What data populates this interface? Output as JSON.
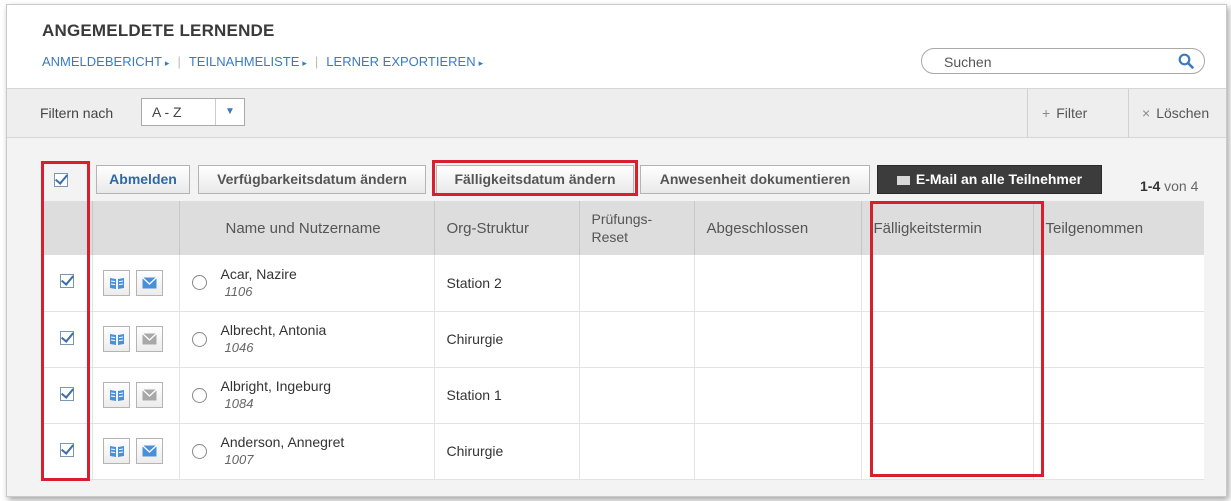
{
  "header": {
    "title": "ANGEMELDETE LERNENDE",
    "links": [
      "ANMELDEBERICHT",
      "TEILNAHMELISTE",
      "LERNER EXPORTIEREN"
    ],
    "search_placeholder": "Suchen"
  },
  "filterbar": {
    "label": "Filtern nach",
    "select_value": "A - Z",
    "filter_label": "Filter",
    "clear_label": "Löschen"
  },
  "toolbar": {
    "unregister": "Abmelden",
    "availability": "Verfügbarkeitsdatum ändern",
    "duedate": "Fälligkeitsdatum ändern",
    "attendance": "Anwesenheit dokumentieren",
    "email_all": "E-Mail an alle Teilnehmer",
    "count_range": "1-4",
    "count_suffix": "von 4"
  },
  "table": {
    "columns": [
      "Name und Nutzername",
      "Org-Struktur",
      "Prüfungs-",
      "Reset",
      "Abgeschlossen",
      "Fälligkeitstermin",
      "Teilgenommen"
    ],
    "rows": [
      {
        "name": "Acar, Nazire",
        "id": "1106",
        "org": "Station 2",
        "mail_active": true
      },
      {
        "name": "Albrecht, Antonia",
        "id": "1046",
        "org": "Chirurgie",
        "mail_active": false
      },
      {
        "name": "Albright, Ingeburg",
        "id": "1084",
        "org": "Station 1",
        "mail_active": false
      },
      {
        "name": "Anderson, Annegret",
        "id": "1007",
        "org": "Chirurgie",
        "mail_active": true
      }
    ]
  },
  "colors": {
    "accent": "#3a7bbf",
    "highlight": "#d71f2e",
    "dark_button": "#3c3c3c"
  },
  "icons": [
    "search-icon",
    "caret-right-icon",
    "chevron-down-icon",
    "plus-icon",
    "close-icon",
    "checkbox-icon",
    "book-icon",
    "mail-icon",
    "radio-icon"
  ]
}
